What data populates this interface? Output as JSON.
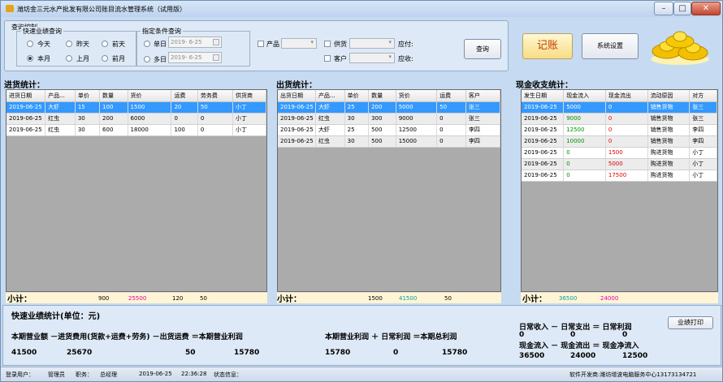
{
  "window": {
    "title": "潍坊金三元水产批发有限公司账目流水管理系统（试用版）",
    "controls": [
      "–",
      "□",
      "✕"
    ]
  },
  "query": {
    "group_label": "查询控制",
    "quick_label": "快速业绩查询",
    "radios": [
      "今天",
      "昨天",
      "前天",
      "本月",
      "上月",
      "前月"
    ],
    "cond_label": "指定条件查询",
    "single_day": "单日",
    "multi_day": "多日",
    "date1": "2019- 6-25",
    "date2": "2019- 6-25",
    "product": "产品",
    "supplier": "供货",
    "customer": "客户",
    "payable": "应付:",
    "receivable": "应收:",
    "query_btn": "查询"
  },
  "buttons": {
    "ledger": "记账",
    "settings": "系统设置",
    "print": "业绩打印"
  },
  "purchase": {
    "title": "进货统计：",
    "headers": [
      "进货日期",
      "产品...",
      "单价",
      "数量",
      "货价",
      "运费",
      "劳务费",
      "供货商"
    ],
    "rows": [
      [
        "2019-06-25",
        "大虾",
        "15",
        "100",
        "1500",
        "20",
        "50",
        "小丁"
      ],
      [
        "2019-06-25",
        "红虫",
        "30",
        "200",
        "6000",
        "0",
        "0",
        "小丁"
      ],
      [
        "2019-06-25",
        "红虫",
        "30",
        "600",
        "18000",
        "100",
        "0",
        "小丁"
      ]
    ],
    "sum_label": "小计：",
    "sums": {
      "qty": "900",
      "price": "25500",
      "freight": "120",
      "labor": "50"
    }
  },
  "sales": {
    "title": "出货统计：",
    "headers": [
      "出货日期",
      "产品...",
      "单价",
      "数量",
      "货价",
      "运费",
      "客户"
    ],
    "rows": [
      [
        "2019-06-25",
        "大虾",
        "25",
        "200",
        "5000",
        "50",
        "张三"
      ],
      [
        "2019-06-25",
        "红虫",
        "30",
        "300",
        "9000",
        "0",
        "张三"
      ],
      [
        "2019-06-25",
        "大虾",
        "25",
        "500",
        "12500",
        "0",
        "李四"
      ],
      [
        "2019-06-25",
        "红虫",
        "30",
        "500",
        "15000",
        "0",
        "李四"
      ]
    ],
    "sum_label": "小计：",
    "sums": {
      "qty": "1500",
      "price": "41500",
      "freight": "50"
    }
  },
  "cash": {
    "title": "现金收支统计：",
    "headers": [
      "发生日期",
      "现金流入",
      "现金流出",
      "流动原因",
      "对方"
    ],
    "rows": [
      [
        "2019-06-25",
        "5000",
        "0",
        "销售货物",
        "张三"
      ],
      [
        "2019-06-25",
        "9000",
        "0",
        "销售货物",
        "张三"
      ],
      [
        "2019-06-25",
        "12500",
        "0",
        "销售货物",
        "李四"
      ],
      [
        "2019-06-25",
        "10000",
        "0",
        "销售货物",
        "李四"
      ],
      [
        "2019-06-25",
        "0",
        "1500",
        "购进货物",
        "小丁"
      ],
      [
        "2019-06-25",
        "0",
        "5000",
        "购进货物",
        "小丁"
      ],
      [
        "2019-06-25",
        "0",
        "17500",
        "购进货物",
        "小丁"
      ]
    ],
    "sum_label": "小计：",
    "sums": {
      "in": "36500",
      "out": "24000"
    }
  },
  "summary": {
    "title": "快速业绩统计(单位：元)",
    "formula1": "本期营业额 －进货费用(货款+运费+劳务) －出货运费 ＝本期营业利润",
    "v1": [
      "41500",
      "25670",
      "50",
      "15780"
    ],
    "formula2": "本期营业利润  ＋ 日常利润 ＝本期总利润",
    "v2": [
      "15780",
      "0",
      "15780"
    ],
    "daily": "日常收入  －  日常支出  ＝  日常利润",
    "daily_v": [
      "0",
      "0",
      "0"
    ],
    "cashf": "现金流入  －  现金流出  ＝  现金净流入",
    "cashf_v": [
      "36500",
      "24000",
      "12500"
    ]
  },
  "status": {
    "user_label": "登录用户：",
    "user": "管理员",
    "role_label": "职务：",
    "role": "总经理",
    "date": "2019-06-25",
    "time": "22:36:28",
    "info_label": "状态信息：",
    "dev": "软件开发商:潍坊增波电脑服务中心13173134721"
  }
}
